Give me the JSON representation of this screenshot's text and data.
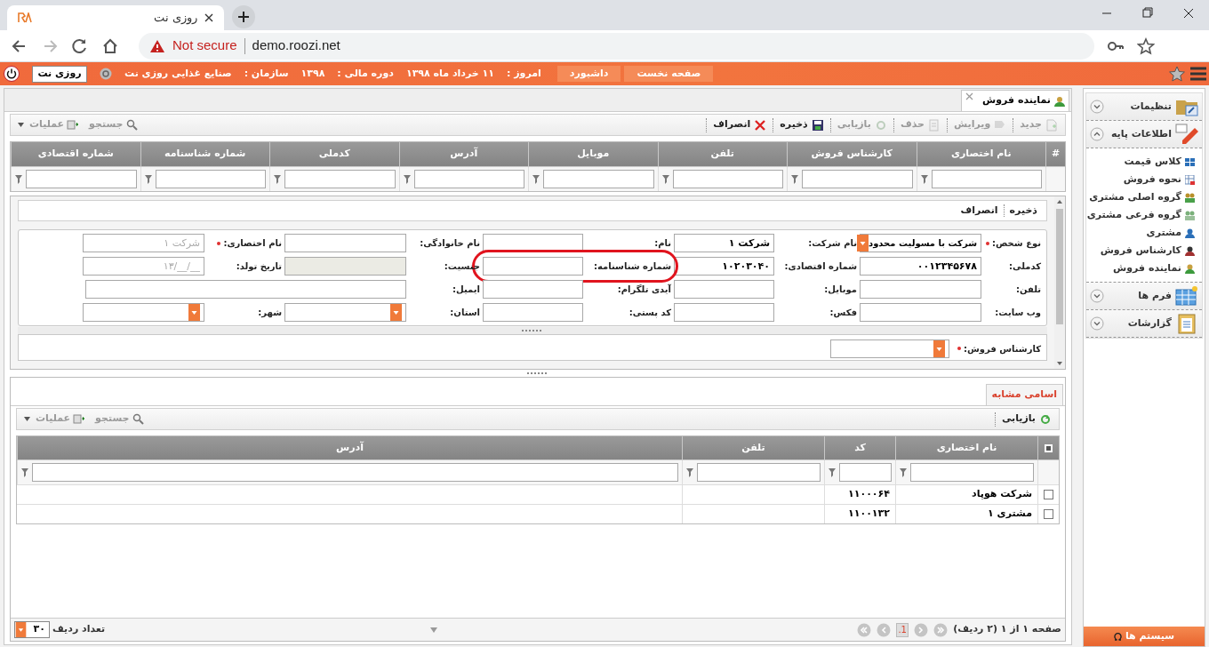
{
  "browser": {
    "tab_title": "روزی نت",
    "security": "Not secure",
    "url": "demo.roozi.net"
  },
  "top_bar": {
    "buttons": [
      "صفحه نخست",
      "داشبورد"
    ],
    "today_label": "امروز :",
    "today": "۱۱ خرداد ماه ۱۳۹۸",
    "fiscal_label": "دوره مالی :",
    "fiscal": "۱۳۹۸",
    "org_label": "سازمان :",
    "org": "صنایع غذایی روزی نت",
    "user": "روزی نت"
  },
  "document_tab": {
    "label": "نماینده فروش"
  },
  "toolbar": {
    "actions": [
      {
        "label": "جدید",
        "disabled": true
      },
      {
        "label": "ویرایش",
        "disabled": true
      },
      {
        "label": "حذف",
        "disabled": true
      },
      {
        "label": "بازیابی",
        "disabled": true
      },
      {
        "label": "ذخیره",
        "disabled": false
      },
      {
        "label": "انصراف",
        "disabled": false
      }
    ],
    "tools": [
      "جستجو",
      "عملیات"
    ]
  },
  "grid": {
    "columns": [
      "#",
      "نام اختصاری",
      "کارشناس فروش",
      "تلفن",
      "موبایل",
      "آدرس",
      "کدملی",
      "شماره شناسنامه",
      "شماره اقتصادی"
    ]
  },
  "form": {
    "actions": [
      "ذخیره",
      "انصراف"
    ],
    "rows": [
      [
        {
          "label": "نوع شخص:",
          "required": true,
          "kind": "select",
          "value": "شرکت با مسولیت محدود"
        },
        {
          "label": "نام شرکت:",
          "required": false,
          "kind": "text",
          "value": "شرکت ۱"
        },
        {
          "label": "نام:",
          "required": false,
          "kind": "text"
        },
        {
          "label": "نام خانوادگی:",
          "required": false,
          "kind": "text"
        },
        {
          "label": "نام اختصاری:",
          "required": true,
          "kind": "text",
          "placeholder": "شرکت ۱"
        }
      ],
      [
        {
          "label": "کدملی:",
          "required": false,
          "kind": "text",
          "value": "۰۰۱۲۳۴۵۶۷۸"
        },
        {
          "label": "شماره اقتصادی:",
          "required": false,
          "kind": "text",
          "value": "۱۰۲۰۳۰۴۰"
        },
        {
          "label": "شماره شناسنامه:",
          "required": false,
          "kind": "text",
          "highlighted": true
        },
        {
          "label": "جنسیت:",
          "required": false,
          "kind": "disabled"
        },
        {
          "label": "تاریخ تولد:",
          "required": false,
          "kind": "text",
          "placeholder": "__/__/۱۳"
        }
      ],
      [
        {
          "label": "تلفن:",
          "required": false,
          "kind": "text"
        },
        {
          "label": "موبایل:",
          "required": false,
          "kind": "text"
        },
        {
          "label": "آیدی تلگرام:",
          "required": false,
          "kind": "text"
        },
        {
          "label": "ایمیل:",
          "required": false,
          "kind": "wide"
        }
      ],
      [
        {
          "label": "وب سایت:",
          "required": false,
          "kind": "text"
        },
        {
          "label": "فکس:",
          "required": false,
          "kind": "text"
        },
        {
          "label": "کد پستی:",
          "required": false,
          "kind": "text"
        },
        {
          "label": "استان:",
          "required": false,
          "kind": "select"
        },
        {
          "label": "شهر:",
          "required": false,
          "kind": "select"
        }
      ]
    ],
    "sales_expert": {
      "label": "کارشناس فروش:",
      "required": true,
      "kind": "select"
    }
  },
  "lower_panel": {
    "tabs": [
      {
        "label": "اسامی مشابه",
        "selected": true
      }
    ],
    "toolbar": {
      "actions": [
        "بازیابی"
      ],
      "tools": [
        "جستجو",
        "عملیات"
      ]
    },
    "table": {
      "columns": [
        "نام اختصاری",
        "کد",
        "تلفن",
        "آدرس"
      ],
      "rows": [
        {
          "name": "شرکت هوپاد",
          "code": "۱۱۰۰۰۶۴",
          "checked": false
        },
        {
          "name": "مشتری ۱",
          "code": "۱۱۰۰۱۳۲",
          "checked": false
        }
      ]
    },
    "pager": {
      "summary": "صفحه ۱ از ۱ (۲ ردیف)",
      "page": "1.",
      "page_size": "۳۰",
      "page_size_label": "تعداد ردیف"
    }
  },
  "sidebar": {
    "sections": [
      {
        "label": "تنظیمات",
        "expanded": false
      },
      {
        "label": "اطلاعات پایه",
        "expanded": true,
        "items": [
          "کلاس قیمت",
          "نحوه فروش",
          "گروه اصلی مشتری",
          "گروه فرعی مشتری",
          "مشتری",
          "کارشناس فروش",
          "نماینده فروش"
        ]
      },
      {
        "label": "فرم ها",
        "expanded": false
      },
      {
        "label": "گزارشات",
        "expanded": false
      }
    ],
    "footer": "سیستم ها"
  }
}
